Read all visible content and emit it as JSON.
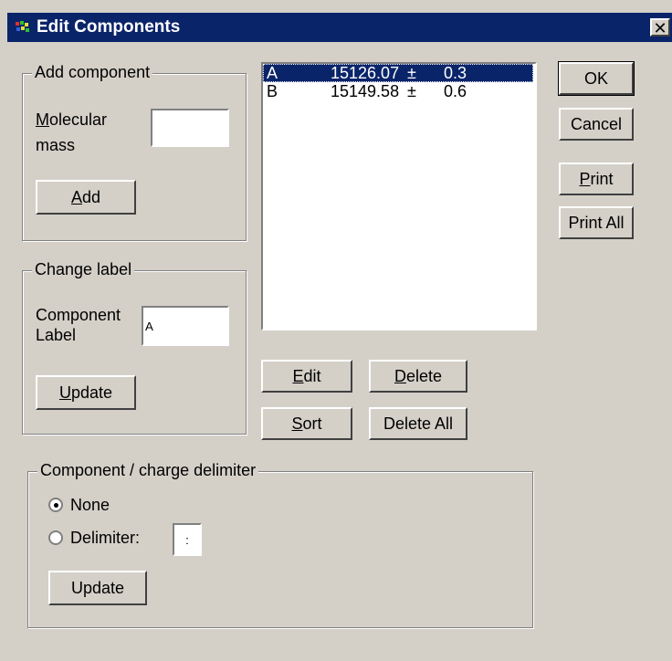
{
  "window": {
    "title": "Edit Components",
    "close_glyph": "✕"
  },
  "add_component": {
    "legend": "Add component",
    "mass_label_line1": "Molecular",
    "mass_label_line2": "mass",
    "mass_value": "",
    "add_button": "Add"
  },
  "change_label": {
    "legend": "Change label",
    "label_line1": "Component",
    "label_line2": "Label",
    "label_value": "A",
    "update_button": "Update"
  },
  "components_list": {
    "rows": [
      {
        "label": "A",
        "mass": "15126.07",
        "pm": "±",
        "error": "0.3",
        "selected": true
      },
      {
        "label": "B",
        "mass": "15149.58",
        "pm": "±",
        "error": "0.6",
        "selected": false
      }
    ]
  },
  "list_buttons": {
    "edit": "Edit",
    "delete": "Delete",
    "sort": "Sort",
    "delete_all": "Delete All"
  },
  "side_buttons": {
    "ok": "OK",
    "cancel": "Cancel",
    "print": "Print",
    "print_all": "Print All"
  },
  "delimiter": {
    "legend": "Component / charge delimiter",
    "option_none": "None",
    "option_delimiter": "Delimiter:",
    "delimiter_value": ":",
    "selected": "None",
    "update_button": "Update"
  }
}
